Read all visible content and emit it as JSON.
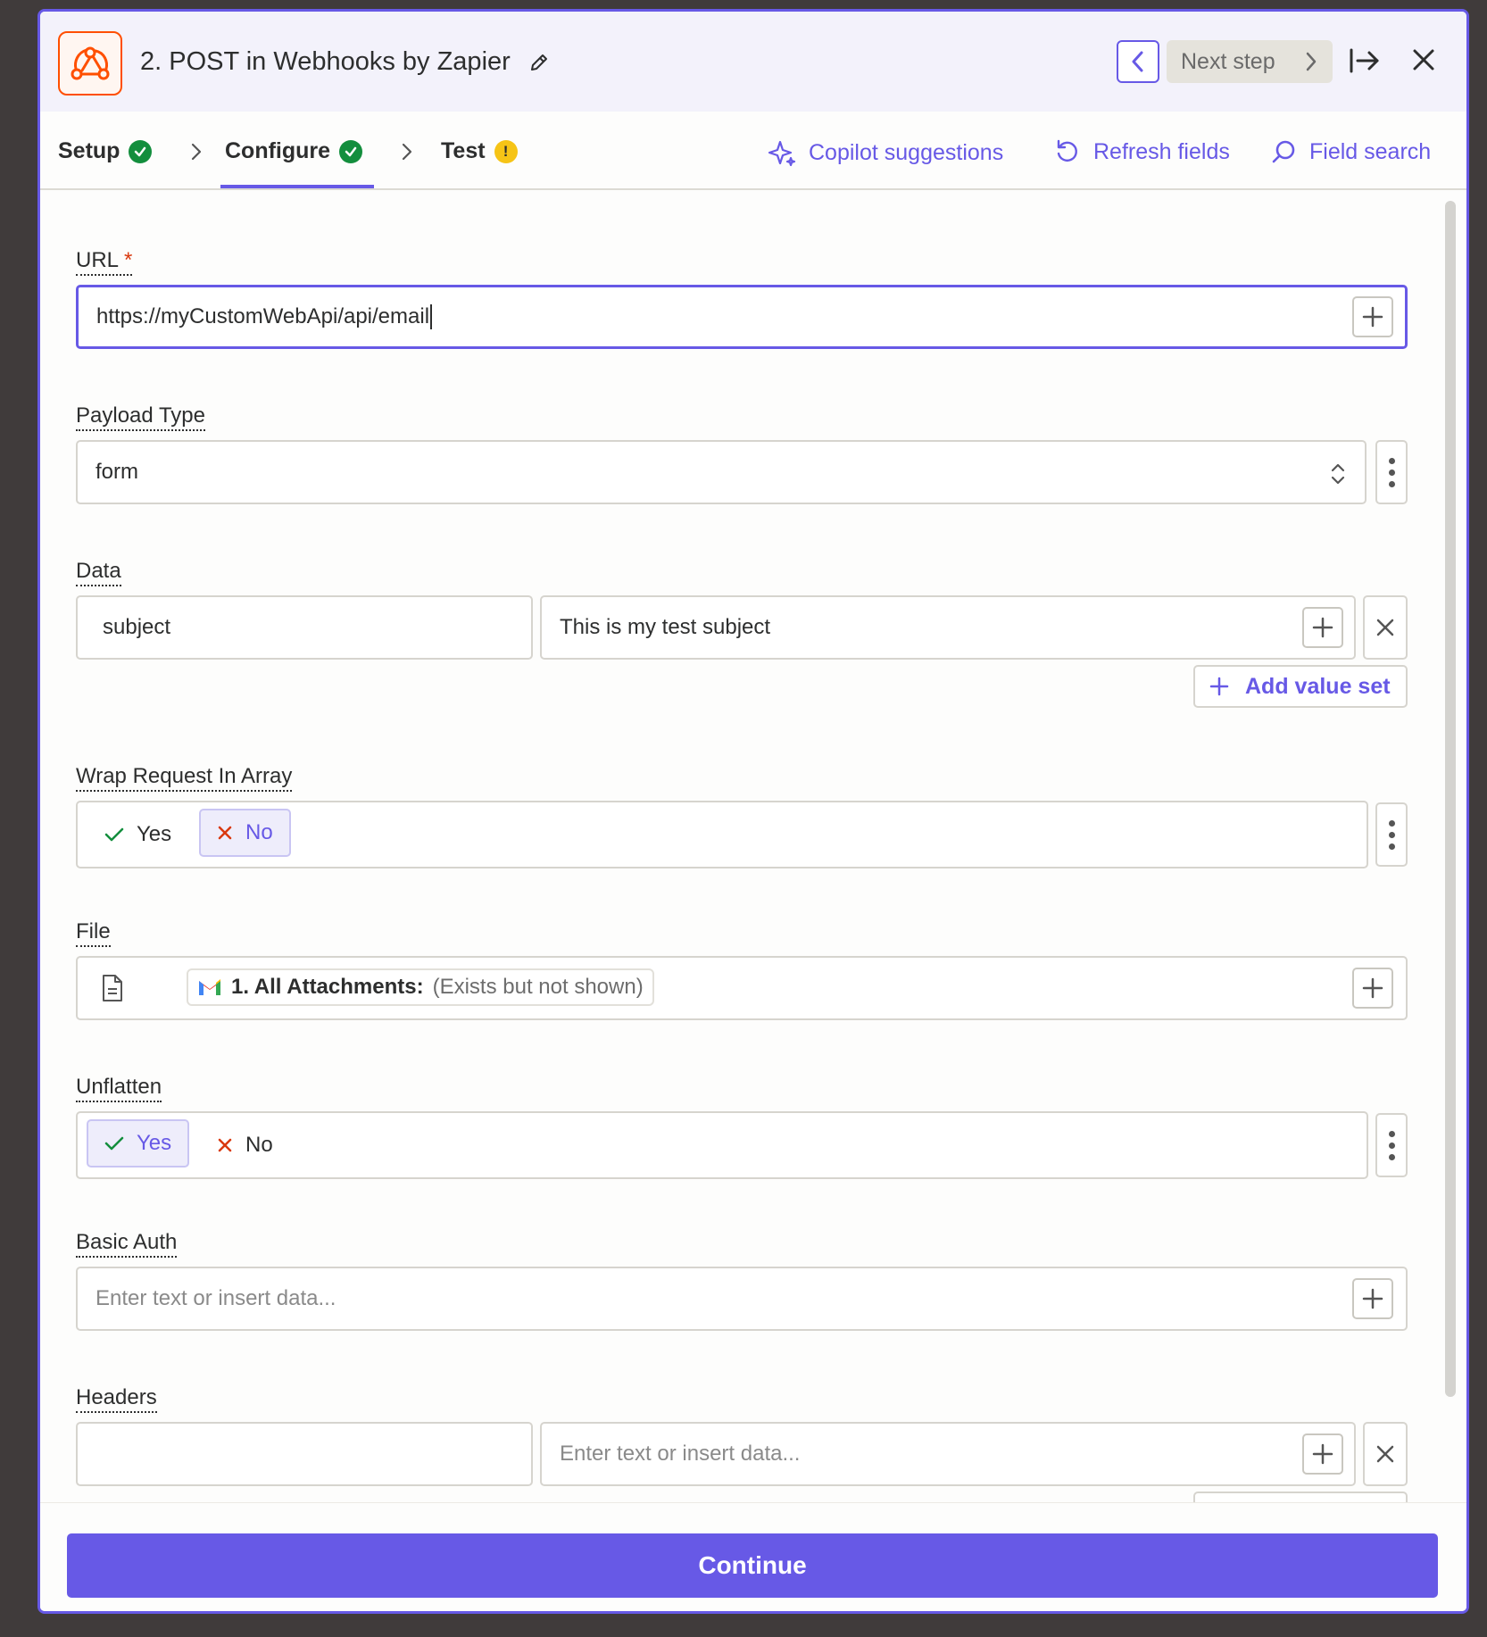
{
  "header": {
    "title": "2. POST in Webhooks by Zapier",
    "next_step_label": "Next step"
  },
  "tabs": [
    {
      "label": "Setup",
      "status": "complete"
    },
    {
      "label": "Configure",
      "status": "complete"
    },
    {
      "label": "Test",
      "status": "warning",
      "badge": "!"
    }
  ],
  "tools": {
    "copilot": "Copilot suggestions",
    "refresh": "Refresh fields",
    "field_search": "Field search"
  },
  "fields": {
    "url": {
      "label": "URL",
      "required_mark": "*",
      "value": "https://myCustomWebApi/api/email"
    },
    "payload_type": {
      "label": "Payload Type",
      "value": "form"
    },
    "data": {
      "label": "Data",
      "key": "subject",
      "value": "This is my test subject",
      "add_label": "Add value set"
    },
    "wrap_request": {
      "label": "Wrap Request In Array",
      "yes": "Yes",
      "no": "No",
      "selected": "No"
    },
    "file": {
      "label": "File",
      "chip_title": "1. All Attachments:",
      "chip_note": "(Exists but not shown)"
    },
    "unflatten": {
      "label": "Unflatten",
      "yes": "Yes",
      "no": "No",
      "selected": "Yes"
    },
    "basic_auth": {
      "label": "Basic Auth",
      "placeholder": "Enter text or insert data..."
    },
    "headers": {
      "label": "Headers",
      "key": "",
      "placeholder": "Enter text or insert data..."
    }
  },
  "footer": {
    "continue_label": "Continue"
  },
  "colors": {
    "accent": "#6759e6",
    "success": "#138e3d",
    "warning": "#f6c416",
    "brand": "#ff4f00"
  }
}
